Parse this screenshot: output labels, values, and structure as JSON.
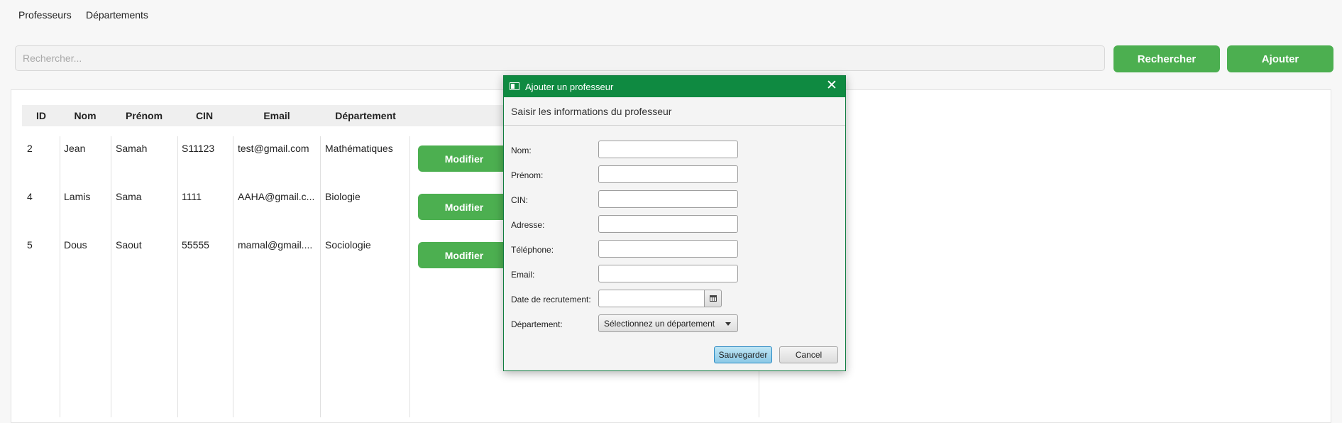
{
  "menu": {
    "items": [
      "Professeurs",
      "Départements"
    ]
  },
  "search": {
    "placeholder": "Rechercher...",
    "value": ""
  },
  "toolbar": {
    "search_label": "Rechercher",
    "add_label": "Ajouter"
  },
  "table": {
    "columns": [
      "ID",
      "Nom",
      "Prénom",
      "CIN",
      "Email",
      "Département"
    ],
    "rows": [
      {
        "id": "2",
        "nom": "Jean",
        "prenom": "Samah",
        "cin": "S11123",
        "email": "test@gmail.com",
        "departement": "Mathématiques",
        "action": "Modifier"
      },
      {
        "id": "4",
        "nom": "Lamis",
        "prenom": "Sama",
        "cin": "1111",
        "email": "AAHA@gmail.c...",
        "departement": "Biologie",
        "action": "Modifier"
      },
      {
        "id": "5",
        "nom": "Dous",
        "prenom": "Saout",
        "cin": "55555",
        "email": "mamal@gmail....",
        "departement": "Sociologie",
        "action": "Modifier"
      }
    ]
  },
  "dialog": {
    "title": "Ajouter un professeur",
    "header": "Saisir les informations du professeur",
    "fields": {
      "nom": {
        "label": "Nom:",
        "value": ""
      },
      "prenom": {
        "label": "Prénom:",
        "value": ""
      },
      "cin": {
        "label": "CIN:",
        "value": ""
      },
      "adresse": {
        "label": "Adresse:",
        "value": ""
      },
      "telephone": {
        "label": "Téléphone:",
        "value": ""
      },
      "email": {
        "label": "Email:",
        "value": ""
      },
      "date_recrutement": {
        "label": "Date de recrutement:",
        "value": ""
      },
      "departement": {
        "label": "Département:",
        "value": "Sélectionnez un département"
      }
    },
    "save_label": "Sauvegarder",
    "cancel_label": "Cancel"
  },
  "colors": {
    "accent_green": "#4caf50",
    "dialog_titlebar": "#0f8a41"
  },
  "icons": {
    "app": "window-icon",
    "close": "close-icon",
    "calendar": "calendar-icon",
    "dropdown": "chevron-down-icon"
  }
}
